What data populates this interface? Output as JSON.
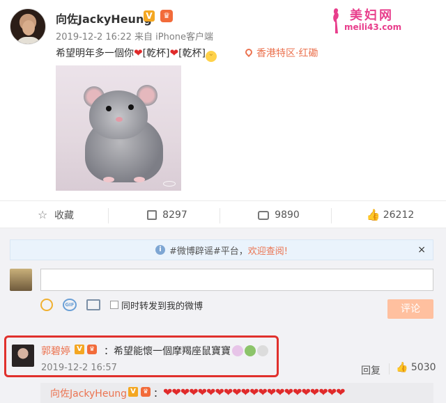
{
  "post": {
    "username": "向佐JackyHeung",
    "verified_badge": "V",
    "member_badge": "crown-icon",
    "meta": "2019-12-2 16:22 来自 iPhone客户端",
    "content_parts": [
      "希望明年多一個你",
      "❤",
      "[乾杯]",
      "❤",
      "[乾杯]"
    ],
    "location": "香港特区·红磡",
    "image_alt": "gray rat photo"
  },
  "watermark": {
    "site_name": "美妇网",
    "site_url": "meili43.com"
  },
  "actions": {
    "favorite_label": "收藏",
    "repost_count": "8297",
    "comment_count": "9890",
    "like_count": "26212"
  },
  "notice": {
    "text_prefix": "#微博辟谣#平台，",
    "link_text": "欢迎查阅!",
    "close": "×"
  },
  "composer": {
    "input_value": "",
    "also_repost_label": "同时转发到我的微博",
    "submit_label": "评论",
    "gif_label": "GIF"
  },
  "comment": {
    "username": "郭碧婷",
    "text": "：希望能懷一個摩羯座鼠寶寶",
    "time": "2019-12-2 16:57",
    "reply_label": "回复",
    "like_count": "5030"
  },
  "reply": {
    "username": "向佐JackyHeung",
    "colon": "：",
    "hearts": "❤❤❤❤❤❤❤❤❤❤❤❤❤❤❤❤❤❤❤❤❤"
  },
  "colors": {
    "accent": "#eb7350",
    "highlight_border": "#e0302c",
    "watermark_pink": "#e83e8c"
  }
}
